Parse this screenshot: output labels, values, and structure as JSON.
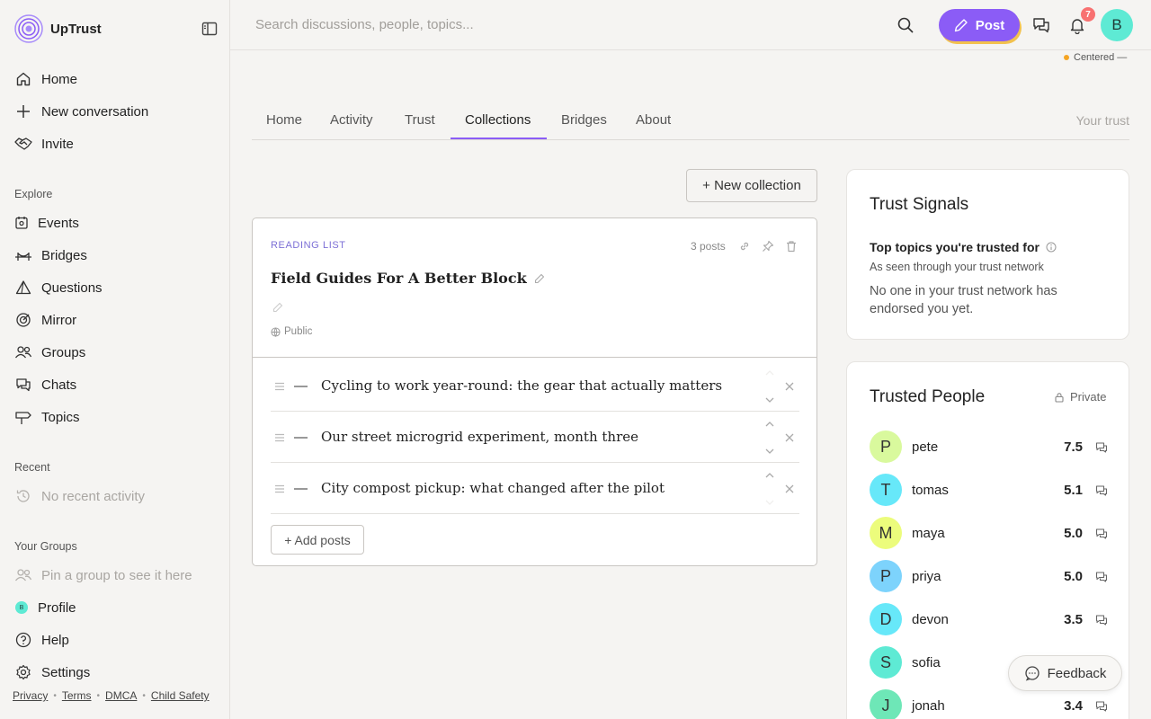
{
  "app": {
    "name": "UpTrust"
  },
  "sidebar": {
    "primary": [
      {
        "label": "Home",
        "icon": "home-icon"
      },
      {
        "label": "New conversation",
        "icon": "plus-icon"
      },
      {
        "label": "Invite",
        "icon": "handshake-icon"
      }
    ],
    "explore_label": "Explore",
    "explore": [
      {
        "label": "Events",
        "icon": "calendar-icon"
      },
      {
        "label": "Bridges",
        "icon": "bridge-icon"
      },
      {
        "label": "Questions",
        "icon": "triangle-icon"
      },
      {
        "label": "Mirror",
        "icon": "target-icon"
      },
      {
        "label": "Groups",
        "icon": "users-icon"
      },
      {
        "label": "Chats",
        "icon": "chats-icon"
      },
      {
        "label": "Topics",
        "icon": "signpost-icon"
      }
    ],
    "recent_label": "Recent",
    "recent_empty": "No recent activity",
    "groups_label": "Your Groups",
    "groups_empty": "Pin a group to see it here",
    "bottom": [
      {
        "label": "Profile",
        "icon": "avatar-icon",
        "initial": "B"
      },
      {
        "label": "Help",
        "icon": "help-icon"
      },
      {
        "label": "Settings",
        "icon": "gear-icon"
      }
    ],
    "footer": [
      "Privacy",
      "Terms",
      "DMCA",
      "Child Safety"
    ]
  },
  "topbar": {
    "search_placeholder": "Search discussions, people, topics...",
    "post_label": "Post",
    "notification_count": "7",
    "user_initial": "B",
    "status_text": "Centered —"
  },
  "tabs": {
    "items": [
      "Home",
      "Activity",
      "Trust",
      "Collections",
      "Bridges",
      "About"
    ],
    "active": "Collections",
    "right_text": "Your trust"
  },
  "collections": {
    "new_button": "+ New collection",
    "card": {
      "type_label": "READING LIST",
      "post_count": "3 posts",
      "title": "Field Guides For A Better Block",
      "visibility": "Public",
      "posts": [
        "Cycling to work year-round: the gear that actually matters",
        "Our street microgrid experiment, month three",
        "City compost pickup: what changed after the pilot"
      ],
      "add_button": "+ Add posts"
    }
  },
  "trust_signals": {
    "title": "Trust Signals",
    "subtitle": "Top topics you're trusted for",
    "caption": "As seen through your trust network",
    "empty": "No one in your trust network has endorsed you yet."
  },
  "trusted_people": {
    "title": "Trusted People",
    "privacy": "Private",
    "people": [
      {
        "initial": "P",
        "name": "pete",
        "score": "7.5",
        "color": "#d9f99d"
      },
      {
        "initial": "T",
        "name": "tomas",
        "score": "5.1",
        "color": "#67e8f9"
      },
      {
        "initial": "M",
        "name": "maya",
        "score": "5.0",
        "color": "#ecfc7c"
      },
      {
        "initial": "P",
        "name": "priya",
        "score": "5.0",
        "color": "#7dd3fc"
      },
      {
        "initial": "D",
        "name": "devon",
        "score": "3.5",
        "color": "#67e8f9"
      },
      {
        "initial": "S",
        "name": "sofia",
        "score": "",
        "color": "#5eead4"
      },
      {
        "initial": "J",
        "name": "jonah",
        "score": "3.4",
        "color": "#6ee7b7"
      }
    ]
  },
  "feedback": {
    "label": "Feedback"
  },
  "colors": {
    "accent": "#8b5cf6",
    "badge": "#f87171",
    "avatar": "#5eead4"
  }
}
